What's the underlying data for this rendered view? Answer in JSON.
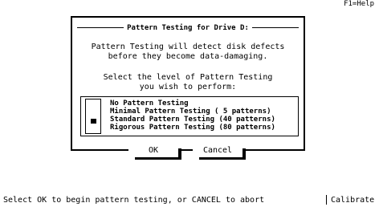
{
  "header": {
    "help_hint": "F1=Help"
  },
  "dialog": {
    "title": "Pattern Testing for Drive D:",
    "description_line1": "Pattern Testing will detect disk defects",
    "description_line2": "before they become data-damaging.",
    "prompt_line1": "Select the level of Pattern Testing",
    "prompt_line2": "you wish to perform:",
    "options": [
      {
        "label": "No Pattern Testing",
        "selected": false
      },
      {
        "label": "Minimal Pattern Testing ( 5 patterns)",
        "selected": false
      },
      {
        "label": "Standard Pattern Testing (40 patterns)",
        "selected": true
      },
      {
        "label": "Rigorous Pattern Testing (80 patterns)",
        "selected": false
      }
    ],
    "buttons": {
      "ok_label": "OK",
      "cancel_label": "Cancel",
      "focused": "OK"
    }
  },
  "status_bar": {
    "message": "Select OK to begin pattern testing, or CANCEL to abort",
    "app_name": "Calibrate"
  }
}
